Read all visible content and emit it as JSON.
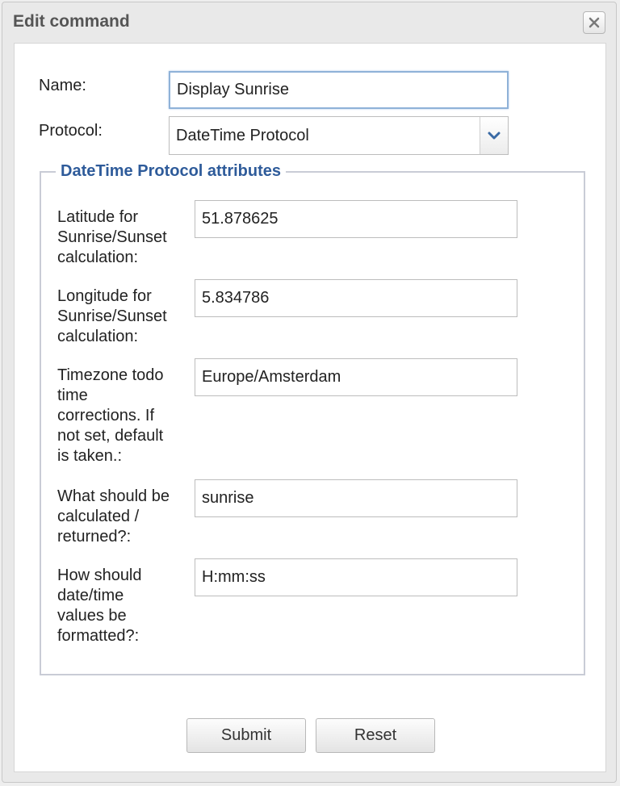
{
  "dialog": {
    "title": "Edit command",
    "close_icon": "close-icon"
  },
  "form": {
    "name_label": "Name:",
    "name_value": "Display Sunrise",
    "protocol_label": "Protocol:",
    "protocol_value": "DateTime Protocol",
    "protocol_dropdown_icon": "chevron-down-icon"
  },
  "attributes": {
    "legend": "DateTime Protocol attributes",
    "fields": [
      {
        "label": [
          "Latitude for",
          "Sunrise/Sunset",
          "calculation:"
        ],
        "value": "51.878625"
      },
      {
        "label": [
          "Longitude for",
          "Sunrise/Sunset",
          "calculation:"
        ],
        "value": "5.834786"
      },
      {
        "label": [
          "Timezone todo",
          "time",
          "corrections. If",
          "not set, default",
          "is taken.:"
        ],
        "value": "Europe/Amsterdam"
      },
      {
        "label": [
          "What should be",
          "calculated /",
          "returned?:"
        ],
        "value": "sunrise"
      },
      {
        "label": [
          "How should",
          "date/time",
          "values be",
          "formatted?:"
        ],
        "value": "H:mm:ss"
      }
    ]
  },
  "buttons": {
    "submit": "Submit",
    "reset": "Reset"
  },
  "colors": {
    "legend": "#2e5b9a",
    "focus_border": "#8fb2d8",
    "chevron": "#3a6aa5"
  }
}
